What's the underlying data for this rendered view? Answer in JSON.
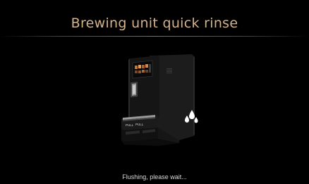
{
  "header": {
    "title": "Brewing unit quick rinse"
  },
  "illustration": {
    "icon": "coffee-machine-illustration",
    "drip_tray_labels": [
      "PULL",
      "PULL"
    ],
    "water_icon": "water-drops-icon"
  },
  "status": {
    "message": "Flushing, please wait..."
  },
  "colors": {
    "background": "#000000",
    "title": "#d4b28a",
    "divider": "#be9164",
    "status_text": "#d9d9d9"
  }
}
